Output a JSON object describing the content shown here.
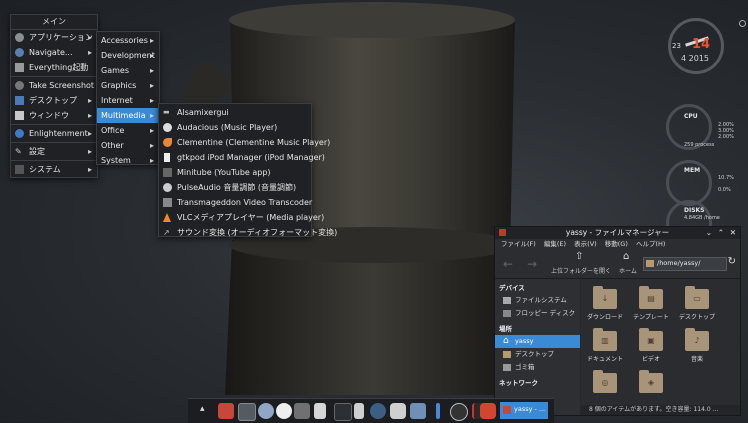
{
  "main_menu": {
    "title": "メイン",
    "items": [
      {
        "label": "アプリケーション",
        "icon": "apps-icon",
        "submenu": true
      },
      {
        "label": "Navigate...",
        "icon": "navigate-icon",
        "submenu": true
      },
      {
        "label": "Everything起動",
        "icon": "everything-icon",
        "submenu": false
      },
      {
        "label": "Take Screenshot",
        "icon": "screenshot-icon",
        "submenu": false
      },
      {
        "label": "デスクトップ",
        "icon": "desktop-icon",
        "submenu": true
      },
      {
        "label": "ウィンドウ",
        "icon": "window-icon",
        "submenu": true
      },
      {
        "label": "Enlightenment",
        "icon": "enlightenment-icon",
        "submenu": true
      },
      {
        "label": "設定",
        "icon": "settings-icon",
        "submenu": true
      },
      {
        "label": "システム",
        "icon": "system-icon",
        "submenu": true
      }
    ]
  },
  "apps_menu": {
    "items": [
      "Accessories",
      "Development",
      "Games",
      "Graphics",
      "Internet",
      "Multimedia",
      "Office",
      "Other",
      "System"
    ],
    "selected": "Multimedia"
  },
  "multimedia_menu": {
    "items": [
      "Alsamixergui",
      "Audacious (Music Player)",
      "Clementine (Clementine Music Player)",
      "gtkpod iPod Manager (iPod Manager)",
      "Minitube (YouTube app)",
      "PulseAudio 音量調節 (音量調節)",
      "Transmageddon Video Transcoder",
      "VLCメディアプレイヤー (Media player)",
      "サウンド変換 (オーディオフォーマット変換)"
    ]
  },
  "clock": {
    "hour": "23",
    "minute": "14",
    "date": "4 2015"
  },
  "cpu": {
    "label": "CPU",
    "lines": [
      "2.00%",
      "3.00%",
      "2.00%"
    ],
    "procs": "259 process"
  },
  "mem": {
    "label": "MEM",
    "lines": [
      "10.7%",
      "0.0%"
    ]
  },
  "disks": {
    "label": "DISKS",
    "line": "4.84GB /home"
  },
  "file_manager": {
    "title": "yassy - ファイルマネージャー",
    "menu": [
      "ファイル(F)",
      "編集(E)",
      "表示(V)",
      "移動(G)",
      "ヘルプ(H)"
    ],
    "toolbar": {
      "up_label": "上位フォルダーを開く",
      "home_label": "ホーム",
      "path": "/home/yassy/"
    },
    "sidebar": {
      "devices_header": "デバイス",
      "devices": [
        "ファイルシステム",
        "フロッピー ディスク"
      ],
      "places_header": "場所",
      "places": [
        "yassy",
        "デスクトップ",
        "ゴミ箱"
      ],
      "network_header": "ネットワーク"
    },
    "files": [
      {
        "name": "ダウンロード",
        "glyph": "↓"
      },
      {
        "name": "テンプレート",
        "glyph": "▤"
      },
      {
        "name": "デスクトップ",
        "glyph": "▭"
      },
      {
        "name": "ドキュメント",
        "glyph": "▥"
      },
      {
        "name": "ビデオ",
        "glyph": "▣"
      },
      {
        "name": "音楽",
        "glyph": "♪"
      },
      {
        "name": "",
        "glyph": "◎"
      },
      {
        "name": "",
        "glyph": "◈"
      }
    ],
    "status": "8 個のアイテムがあります。空き容量: 114.0 ..."
  },
  "shelf": {
    "task_label": "yassy - ..."
  }
}
